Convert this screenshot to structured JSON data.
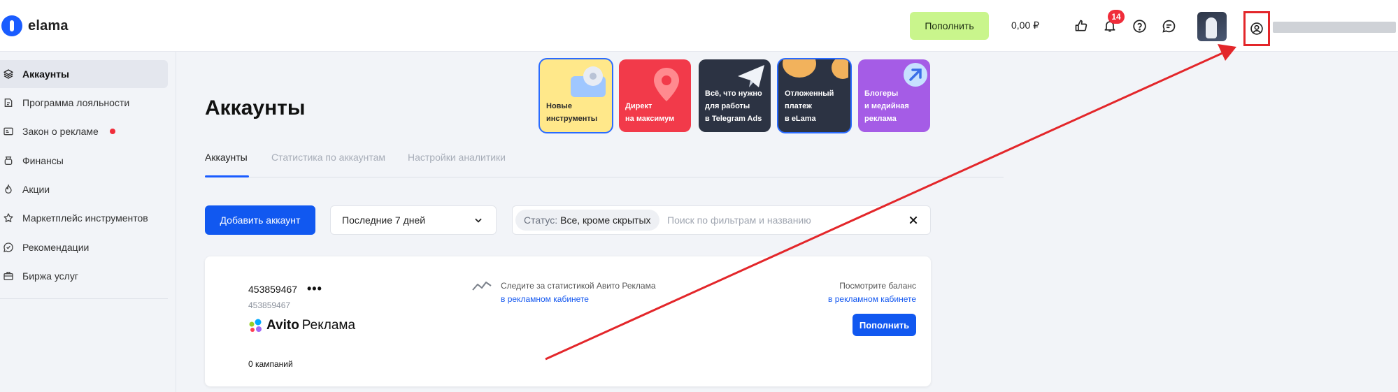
{
  "header": {
    "logo_text": "elama",
    "topup_label": "Пополнить",
    "balance": "0,00 ₽",
    "notifications_count": "14"
  },
  "sidebar": {
    "items": [
      {
        "label": "Аккаунты",
        "icon": "layers-icon",
        "active": true
      },
      {
        "label": "Программа лояльности",
        "icon": "loyalty-icon"
      },
      {
        "label": "Закон о рекламе",
        "icon": "id-card-icon",
        "alert": true
      },
      {
        "label": "Финансы",
        "icon": "wallet-icon"
      },
      {
        "label": "Акции",
        "icon": "fire-icon"
      },
      {
        "label": "Маркетплейс инструментов",
        "icon": "star-icon"
      },
      {
        "label": "Рекомендации",
        "icon": "chat-check-icon"
      },
      {
        "label": "Биржа услуг",
        "icon": "briefcase-icon"
      }
    ]
  },
  "main": {
    "title": "Аккаунты",
    "banners": [
      {
        "text": [
          "Новые",
          "инструменты"
        ],
        "color": "#ffe88a",
        "text_color": "#2b2b2b",
        "selected": true
      },
      {
        "text": [
          "Директ",
          "на максимум"
        ],
        "color": "#f23a4a",
        "text_color": "#ffffff"
      },
      {
        "text": [
          "Всё, что нужно",
          "для работы",
          "в Telegram Ads"
        ],
        "color": "#2c3343",
        "text_color": "#ffffff"
      },
      {
        "text": [
          "Отложенный",
          "платеж",
          "в eLama"
        ],
        "color": "#2c3343",
        "text_color": "#ffffff",
        "selected": true
      },
      {
        "text": [
          "Блогеры",
          "и медийная",
          "реклама"
        ],
        "color": "#a55ce6",
        "text_color": "#ffffff"
      }
    ],
    "tabs": [
      "Аккаунты",
      "Статистика по аккаунтам",
      "Настройки аналитики"
    ],
    "add_account_label": "Добавить аккаунт",
    "period_label": "Последние 7 дней",
    "filter": {
      "status_key": "Статус:",
      "status_value": "Все, кроме скрытых",
      "placeholder": "Поиск по фильтрам и названию"
    },
    "account": {
      "id": "453859467",
      "menu": "•••",
      "sub_id": "453859467",
      "platform_brand": "Avito",
      "platform_product": "Реклама",
      "campaigns": "0 кампаний",
      "stats_text": "Следите за статистикой Авито Реклама",
      "stats_link": "в рекламном кабинете",
      "balance_text": "Посмотрите баланс",
      "balance_link": "в рекламном кабинете",
      "topup_label": "Пополнить"
    }
  },
  "colors": {
    "accent": "#1158f0",
    "topup_green": "#c9f58c",
    "annotation_red": "#e3262a"
  }
}
